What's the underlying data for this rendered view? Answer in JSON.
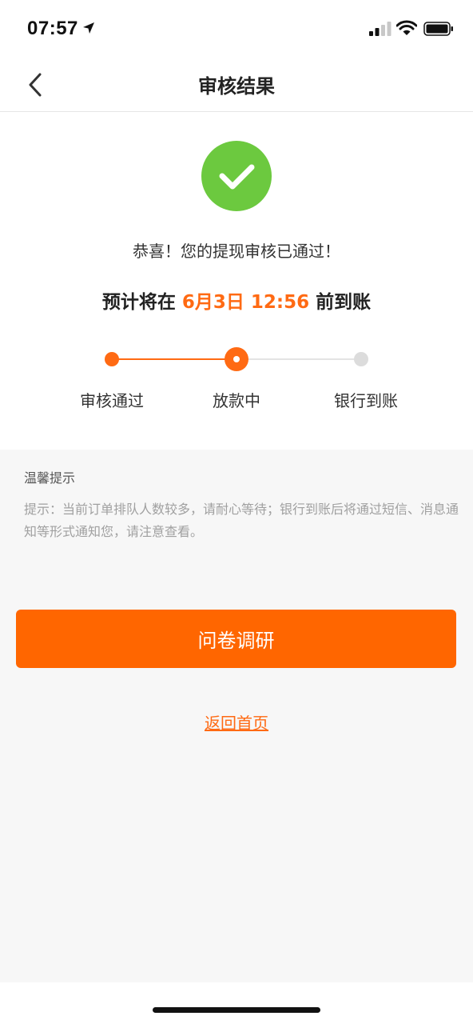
{
  "status_bar": {
    "time": "07:57"
  },
  "nav": {
    "title": "审核结果"
  },
  "result": {
    "congrats": "恭喜！您的提现审核已通过！",
    "eta_prefix": "预计将在 ",
    "eta_date": "6月3日 12:56",
    "eta_suffix": " 前到账"
  },
  "progress": {
    "steps": [
      {
        "label": "审核通过",
        "state": "done"
      },
      {
        "label": "放款中",
        "state": "current"
      },
      {
        "label": "银行到账",
        "state": "pending"
      }
    ]
  },
  "tips": {
    "title": "温馨提示",
    "body": "提示：当前订单排队人数较多，请耐心等待；银行到账后将通过短信、消息通知等形式通知您，请注意查看。"
  },
  "actions": {
    "survey_label": "问卷调研",
    "home_link_label": "返回首页"
  },
  "colors": {
    "accent": "#ff6a13",
    "success": "#6cc93f",
    "button": "#ff6600"
  }
}
